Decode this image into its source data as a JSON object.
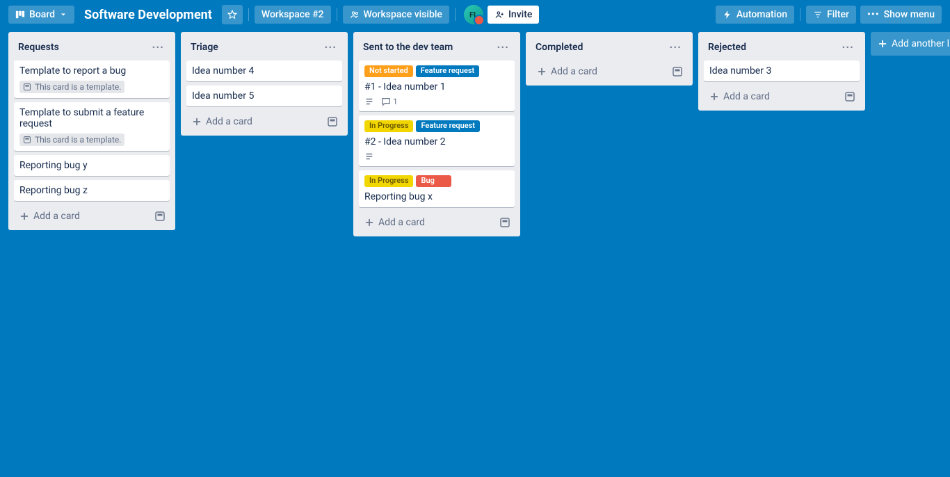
{
  "header": {
    "board_btn": "Board",
    "title": "Software Development",
    "workspace": "Workspace #2",
    "visibility": "Workspace visible",
    "avatar_initials": "FL",
    "invite": "Invite",
    "automation": "Automation",
    "filter": "Filter",
    "show_menu": "Show menu"
  },
  "labels": {
    "not_started": "Not started",
    "feature_request": "Feature request",
    "in_progress": "In Progress",
    "bug": "Bug"
  },
  "misc": {
    "add_card": "Add a card",
    "add_list": "Add another list",
    "template_card_text": "This card is a template."
  },
  "lists": [
    {
      "title": "Requests",
      "cards": [
        {
          "title": "Template to report a bug",
          "is_template": true
        },
        {
          "title": "Template to submit a feature request",
          "is_template": true
        },
        {
          "title": "Reporting bug y"
        },
        {
          "title": "Reporting bug z"
        }
      ]
    },
    {
      "title": "Triage",
      "cards": [
        {
          "title": "Idea number 4"
        },
        {
          "title": "Idea number 5"
        }
      ]
    },
    {
      "title": "Sent to the dev team",
      "cards": [
        {
          "title": "#1 - Idea number 1",
          "labels": [
            "not_started",
            "feature_request"
          ],
          "has_description": true,
          "comments": 1
        },
        {
          "title": "#2 - Idea number 2",
          "labels": [
            "in_progress",
            "feature_request"
          ],
          "has_description": true
        },
        {
          "title": "Reporting bug x",
          "labels": [
            "in_progress",
            "bug"
          ]
        }
      ]
    },
    {
      "title": "Completed",
      "cards": []
    },
    {
      "title": "Rejected",
      "cards": [
        {
          "title": "Idea number 3"
        }
      ]
    }
  ]
}
